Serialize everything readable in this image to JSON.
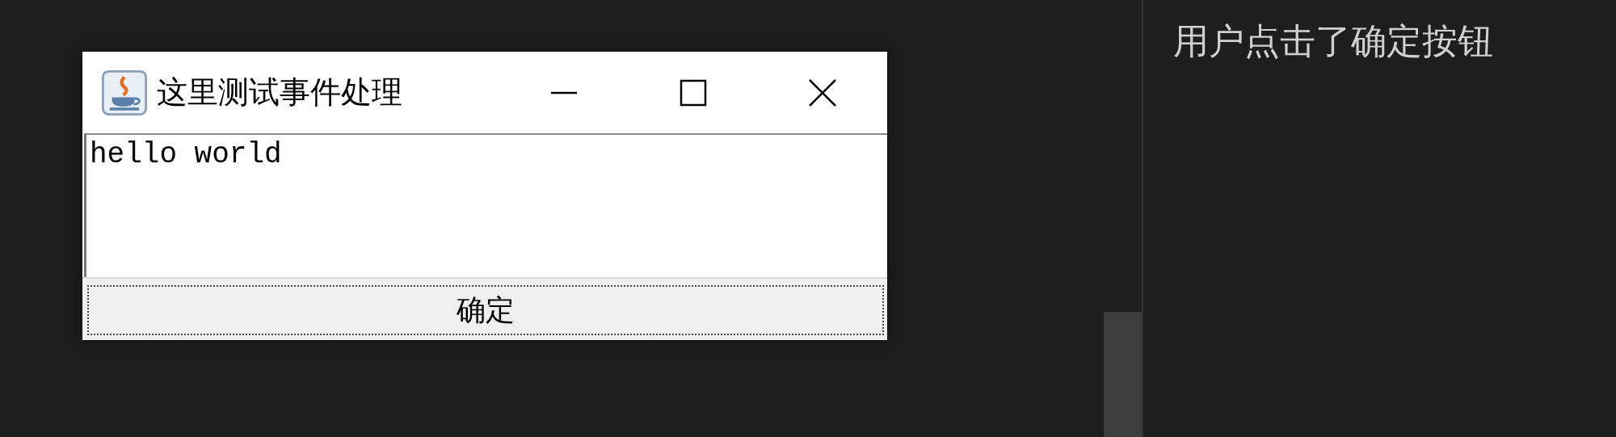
{
  "window": {
    "title": "这里测试事件处理"
  },
  "text_area": {
    "value": "hello world"
  },
  "buttons": [
    {
      "label": "确定"
    }
  ],
  "output": {
    "lines": [
      "用户点击了确定按钮"
    ]
  }
}
